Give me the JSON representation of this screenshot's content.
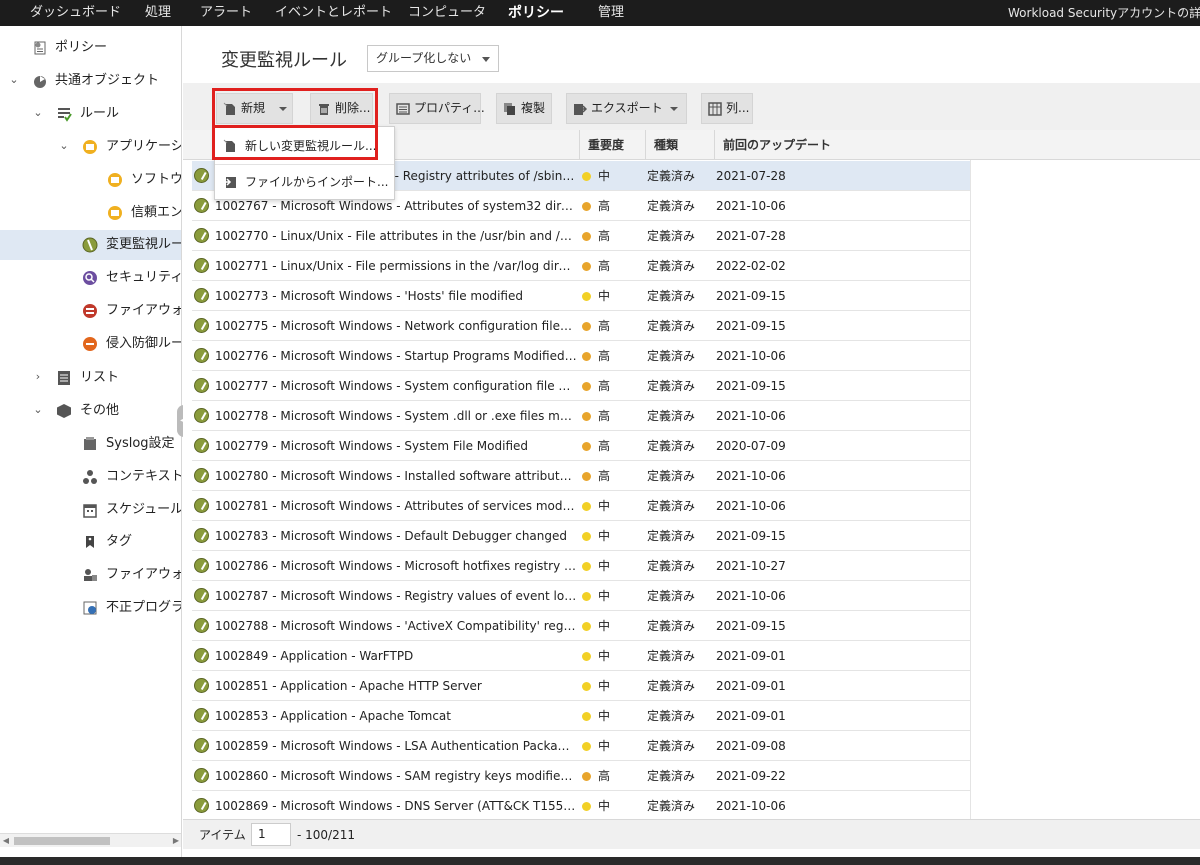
{
  "topnav": {
    "items": [
      "ダッシュボード",
      "処理",
      "アラート",
      "イベントとレポート",
      "コンピュータ",
      "ポリシー",
      "管理"
    ],
    "active": "ポリシー",
    "account": "Workload Securityアカウントの詳細"
  },
  "sidebar": {
    "items": [
      {
        "label": "ポリシー",
        "icon": "policy-icon"
      },
      {
        "label": "共通オブジェクト",
        "icon": "common-objects-icon"
      },
      {
        "label": "ルール",
        "icon": "rules-icon"
      },
      {
        "label": "アプリケーショ",
        "icon": "application-icon"
      },
      {
        "label": "ソフトウェ",
        "icon": "software-icon"
      },
      {
        "label": "信頼エンシ",
        "icon": "trust-entity-icon"
      },
      {
        "label": "変更監視ルー",
        "icon": "integrity-monitoring-icon"
      },
      {
        "label": "セキュリティロ",
        "icon": "security-log-icon"
      },
      {
        "label": "ファイアウォー",
        "icon": "firewall-icon"
      },
      {
        "label": "侵入防御ルー",
        "icon": "intrusion-prevention-icon"
      },
      {
        "label": "リスト",
        "icon": "list-icon"
      },
      {
        "label": "その他",
        "icon": "other-icon"
      },
      {
        "label": "Syslog設定",
        "icon": "syslog-icon"
      },
      {
        "label": "コンテキスト",
        "icon": "context-icon"
      },
      {
        "label": "スケジュール",
        "icon": "schedule-icon"
      },
      {
        "label": "タグ",
        "icon": "tag-icon"
      },
      {
        "label": "ファイアウォー",
        "icon": "firewall-stateful-icon"
      },
      {
        "label": "不正プログラム",
        "icon": "malware-icon"
      }
    ]
  },
  "main": {
    "title": "変更監視ルール",
    "group_select": "グループ化しない"
  },
  "toolbar": {
    "new": "新規",
    "delete": "削除...",
    "properties": "プロパティ...",
    "duplicate": "複製",
    "export": "エクスポート",
    "columns": "列..."
  },
  "dropdown": {
    "new_rule": "新しい変更監視ルール...",
    "import": "ファイルからインポート..."
  },
  "table": {
    "headers": {
      "severity": "重要度",
      "type": "種類",
      "updated": "前回のアップデート"
    },
    "rows": [
      {
        "name": "1002xxx - Microsoft Windows - Registry attributes of /sbin modified …",
        "sev": "中",
        "kind": "定義済み",
        "updated": "2021-07-28"
      },
      {
        "name": "1002767 - Microsoft Windows - Attributes of system32 direct…",
        "sev": "高",
        "kind": "定義済み",
        "updated": "2021-10-06"
      },
      {
        "name": "1002770 - Linux/Unix - File attributes in the /usr/bin and /us…",
        "sev": "高",
        "kind": "定義済み",
        "updated": "2021-07-28"
      },
      {
        "name": "1002771 - Linux/Unix - File permissions in the /var/log direct…",
        "sev": "高",
        "kind": "定義済み",
        "updated": "2022-02-02"
      },
      {
        "name": "1002773 - Microsoft Windows - 'Hosts' file modified",
        "sev": "中",
        "kind": "定義済み",
        "updated": "2021-09-15"
      },
      {
        "name": "1002775 - Microsoft Windows - Network configuration files mo…",
        "sev": "高",
        "kind": "定義済み",
        "updated": "2021-09-15"
      },
      {
        "name": "1002776 - Microsoft Windows - Startup Programs Modified (A…",
        "sev": "高",
        "kind": "定義済み",
        "updated": "2021-10-06"
      },
      {
        "name": "1002777 - Microsoft Windows - System configuration file modi…",
        "sev": "高",
        "kind": "定義済み",
        "updated": "2021-09-15"
      },
      {
        "name": "1002778 - Microsoft Windows - System .dll or .exe files modifi…",
        "sev": "高",
        "kind": "定義済み",
        "updated": "2021-10-06"
      },
      {
        "name": "1002779 - Microsoft Windows - System File Modified",
        "sev": "高",
        "kind": "定義済み",
        "updated": "2020-07-09"
      },
      {
        "name": "1002780 - Microsoft Windows - Installed software attributes m…",
        "sev": "高",
        "kind": "定義済み",
        "updated": "2021-10-06"
      },
      {
        "name": "1002781 - Microsoft Windows - Attributes of services modifie…",
        "sev": "中",
        "kind": "定義済み",
        "updated": "2021-10-06"
      },
      {
        "name": "1002783 - Microsoft Windows - Default Debugger changed",
        "sev": "中",
        "kind": "定義済み",
        "updated": "2021-09-15"
      },
      {
        "name": "1002786 - Microsoft Windows - Microsoft hotfixes registry ke…",
        "sev": "中",
        "kind": "定義済み",
        "updated": "2021-10-27"
      },
      {
        "name": "1002787 - Microsoft Windows - Registry values of event log m…",
        "sev": "中",
        "kind": "定義済み",
        "updated": "2021-10-06"
      },
      {
        "name": "1002788 - Microsoft Windows - 'ActiveX Compatibility' registr…",
        "sev": "中",
        "kind": "定義済み",
        "updated": "2021-09-15"
      },
      {
        "name": "1002849 - Application - WarFTPD",
        "sev": "中",
        "kind": "定義済み",
        "updated": "2021-09-01"
      },
      {
        "name": "1002851 - Application - Apache HTTP Server",
        "sev": "中",
        "kind": "定義済み",
        "updated": "2021-09-01"
      },
      {
        "name": "1002853 - Application - Apache Tomcat",
        "sev": "中",
        "kind": "定義済み",
        "updated": "2021-09-01"
      },
      {
        "name": "1002859 - Microsoft Windows - LSA Authentication Packages …",
        "sev": "中",
        "kind": "定義済み",
        "updated": "2021-09-08"
      },
      {
        "name": "1002860 - Microsoft Windows - SAM registry keys modified (A…",
        "sev": "高",
        "kind": "定義済み",
        "updated": "2021-09-22"
      },
      {
        "name": "1002869 - Microsoft Windows - DNS Server (ATT&CK T1554, …",
        "sev": "中",
        "kind": "定義済み",
        "updated": "2021-10-06"
      }
    ]
  },
  "colors": {
    "sev_high": "#e8a52c",
    "sev_medium": "#f2d026"
  },
  "pager": {
    "label": "アイテム",
    "page": "1",
    "range": "- 100/211"
  }
}
